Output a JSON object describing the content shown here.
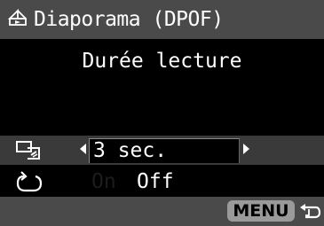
{
  "header": {
    "title": "Diaporama (DPOF)",
    "icon": "slideshow-play-icon"
  },
  "subtitle": "Durée lecture",
  "settings": {
    "playback_time": {
      "icon": "playback-time-icon",
      "value": "3 sec."
    },
    "repeat": {
      "icon": "repeat-icon",
      "options": [
        "On",
        "Off"
      ],
      "selected": "Off"
    }
  },
  "footer": {
    "menu_label": "MENU",
    "return_icon": "return-arrow-icon"
  },
  "colors": {
    "bar_gray": "#4a4a4a",
    "row_highlight": "#3a3a3a",
    "background": "#000000",
    "menu_button": "#9a9a9a"
  }
}
